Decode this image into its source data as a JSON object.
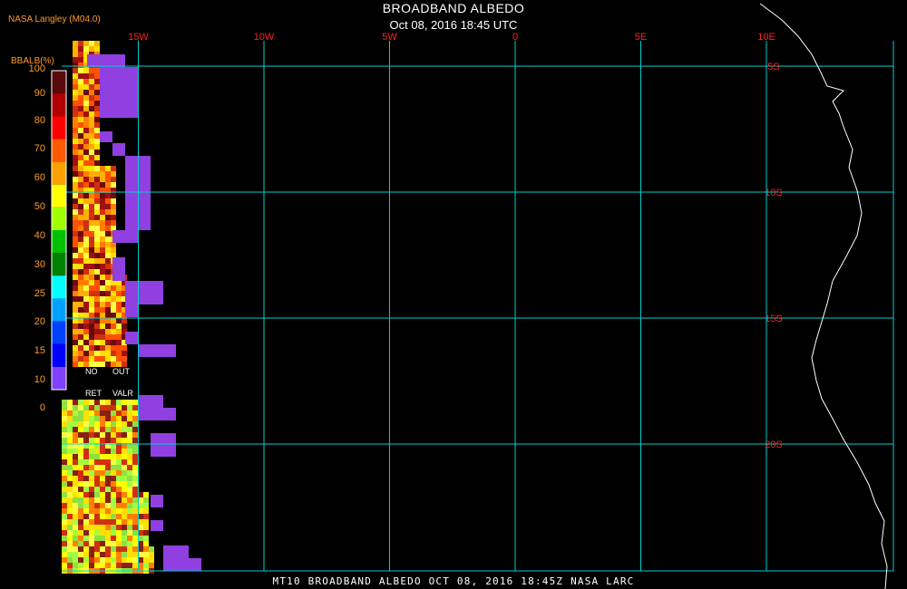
{
  "header": {
    "credit": "NASA Langley (M04.0)",
    "title": "BROADBAND ALBEDO",
    "subtitle": "Oct 08, 2016 18:45 UTC"
  },
  "footer": {
    "caption": "MT10   BROADBAND ALBEDO   OCT 08, 2016 18:45Z   NASA LARC"
  },
  "colorbar": {
    "unit_label": "BBALB(%)",
    "ticks": [
      "100",
      "90",
      "80",
      "70",
      "60",
      "50",
      "40",
      "30",
      "25",
      "20",
      "15",
      "10",
      "0"
    ],
    "colors": [
      "#5a0a0a",
      "#b00000",
      "#ff0000",
      "#ff5a00",
      "#ffa000",
      "#ffff00",
      "#a0ff00",
      "#00c000",
      "#008000",
      "#00ffff",
      "#00a0ff",
      "#0040ff",
      "#0000ff",
      "#8040ff"
    ],
    "no_ret_label": [
      "NO",
      "RET"
    ],
    "out_valr_label": [
      "OUT",
      "VALR"
    ]
  },
  "map": {
    "longitude_labels": [
      "15W",
      "10W",
      "5W",
      "0",
      "5E",
      "10E"
    ],
    "longitudes": [
      -15,
      -10,
      -5,
      0,
      5,
      10
    ],
    "latitude_labels": [
      "5S",
      "10S",
      "15S",
      "20S"
    ],
    "latitudes": [
      -5,
      -10,
      -15,
      -20
    ],
    "grid_color": "#00d0d0",
    "label_color": "#ff2020",
    "coastline_color": "#ffffff",
    "no_retrieval_color": "#9040e0"
  }
}
